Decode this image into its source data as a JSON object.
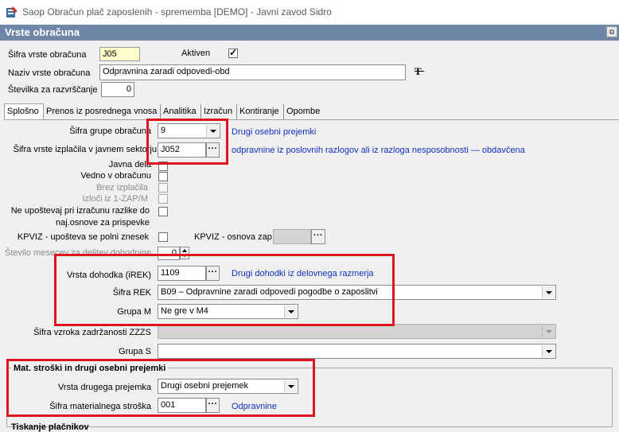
{
  "window": {
    "title": "Saop Obračun plač zaposlenih - sprememba [DEMO] - Javni zavod Sidro"
  },
  "form": {
    "title": "Vrste obračuna"
  },
  "header": {
    "sifra_label": "Šifra vrste obračuna",
    "sifra_value": "J05",
    "aktiven_label": "Aktiven",
    "naziv_label": "Naziv vrste obračuna",
    "naziv_value": "Odpravnina zaradi odpovedi-obd",
    "stevilka_label": "Številka  za razvrščanje",
    "stevilka_value": "0"
  },
  "tabs": [
    {
      "label": "Splošno"
    },
    {
      "label": "Prenos iz posrednega vnosa"
    },
    {
      "label": "Analitika"
    },
    {
      "label": "Izračun"
    },
    {
      "label": "Kontiranje"
    },
    {
      "label": "Opombe"
    }
  ],
  "general": {
    "sifra_grupe_label": "Šifra grupe obračuna",
    "sifra_grupe_value": "9",
    "sifra_grupe_desc": "Drugi osebni prejemki",
    "sifra_izplacila_label": "Šifra vrste izplačila v javnem sektorju",
    "sifra_izplacila_value": "J052",
    "sifra_izplacila_desc": "odpravnine iz poslovnih razlogov ali iz razloga nesposobnosti — obdavčena",
    "javna_dela_label": "Javna dela",
    "vedno_label": "Vedno v obračunu",
    "brez_label": "Brez izplačila",
    "izloci_label": "Izloči iz 1-ZAP/M",
    "neupostevaj_label_1": "Ne upoštevaj pri izračunu razlike do",
    "neupostevaj_label_2": "naj.osnove za prispevke",
    "kpviz_label": "KPVIZ - upošteva se polni znesek",
    "kpviz_osnova_label": "KPVIZ - osnova zap.",
    "stevilo_label": "Število mesecev za delitev dohodnine",
    "stevilo_value": "0",
    "vrsta_dohodka_label": "Vrsta dohodka (iREK)",
    "vrsta_dohodka_value": "1109",
    "vrsta_dohodka_desc": "Drugi dohodki iz delovnega razmerja",
    "sifra_rek_label": "Šifra REK",
    "sifra_rek_value": "B09 – Odpravnine zaradi odpovedi pogodbe o zaposlitvi",
    "grupa_m_label": "Grupa M",
    "grupa_m_value": "Ne gre v M4",
    "zzzs_label": "Šifra vzroka zadržanosti ZZZS",
    "grupa_s_label": "Grupa S"
  },
  "mat": {
    "title": "Mat. stroški in drugi osebni prejemki",
    "vrsta_label": "Vrsta drugega prejemka",
    "vrsta_value": "Drugi osebni prejemek",
    "sifra_label": "Šifra materialnega stroška",
    "sifra_value": "001",
    "sifra_desc": "Odpravnine"
  },
  "footer": {
    "cut_label": "Tiskanje plačnikov"
  },
  "icons": {
    "app": "app-icon",
    "font": "font-tool-icon",
    "ellipsis": "ellipsis-icon"
  },
  "colors": {
    "highlight": "#e0141e",
    "link": "#1030c0",
    "header": "#6f86a8"
  }
}
